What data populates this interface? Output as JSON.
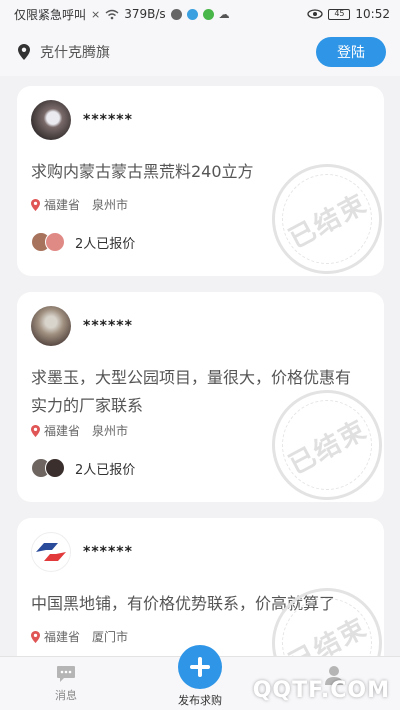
{
  "status_bar": {
    "carrier": "仅限紧急呼叫",
    "network_speed": "379B/s",
    "battery": "45",
    "time": "10:52"
  },
  "header": {
    "location": "克什克腾旗",
    "login_label": "登陆"
  },
  "posts": [
    {
      "user_name": "******",
      "title": "求购内蒙古蒙古黑荒料240立方",
      "province": "福建省",
      "city": "泉州市",
      "quote_text": "2人已报价",
      "stamp_text": "已结束"
    },
    {
      "user_name": "******",
      "title": "求墨玉，大型公园项目，量很大，价格优惠有实力的厂家联系",
      "province": "福建省",
      "city": "泉州市",
      "quote_text": "2人已报价",
      "stamp_text": "已结束"
    },
    {
      "user_name": "******",
      "title": "中国黑地铺，有价格优势联系，价高就算了",
      "province": "福建省",
      "city": "厦门市",
      "stamp_text": "已结束"
    }
  ],
  "tab_bar": {
    "messages_label": "消息",
    "publish_label": "发布求购"
  },
  "watermark": "QQTF.COM",
  "colors": {
    "accent": "#2f95e6",
    "background": "#f2f2f4",
    "card": "#ffffff"
  },
  "icons": {
    "location": "map-pin-icon",
    "publish": "plus-icon",
    "messages": "chat-bubble-icon",
    "profile": "person-icon"
  }
}
